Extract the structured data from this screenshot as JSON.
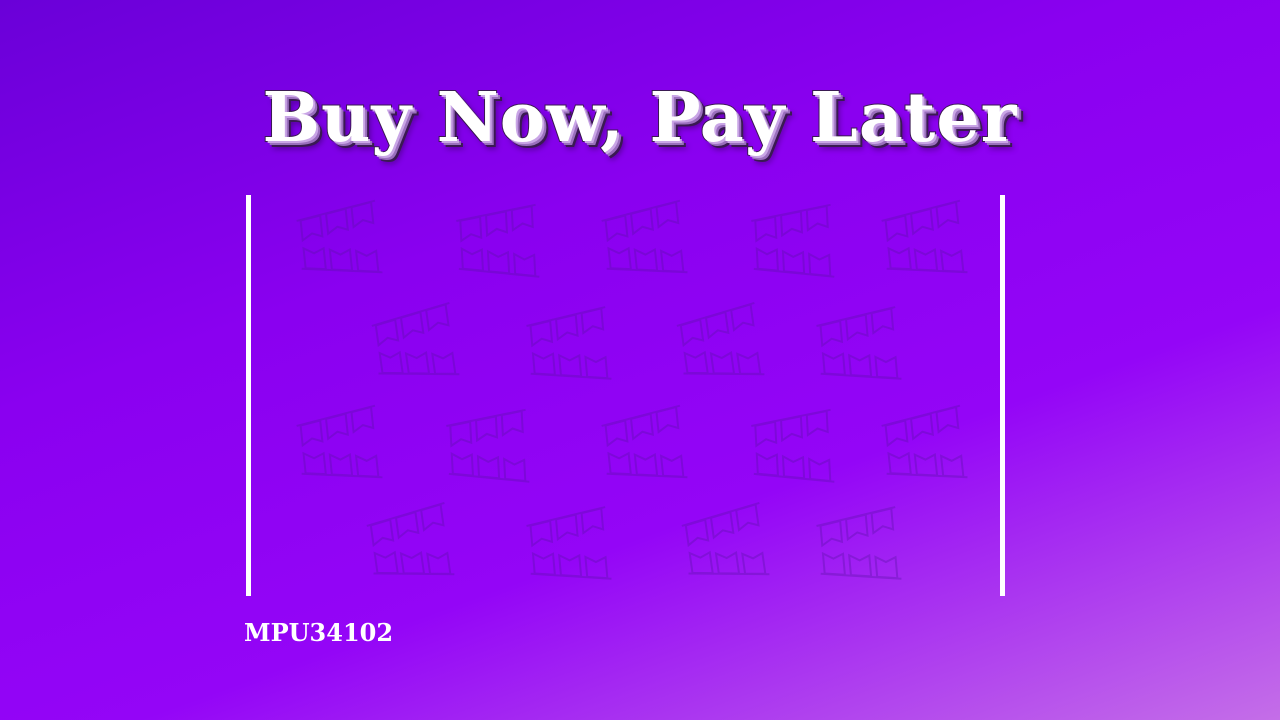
{
  "banner": {
    "title": "Buy Now, Pay Later",
    "code": "MPU34102"
  },
  "pattern": {
    "icon": "bunting-flag-icon",
    "color": "#5a12a6"
  },
  "colors": {
    "background_start": "#6a00d8",
    "background_mid": "#9405f7",
    "background_end": "#c46ee8",
    "rail": "#ffffff",
    "title_text": "#ffffff",
    "title_shadow": "#3a1a52"
  }
}
